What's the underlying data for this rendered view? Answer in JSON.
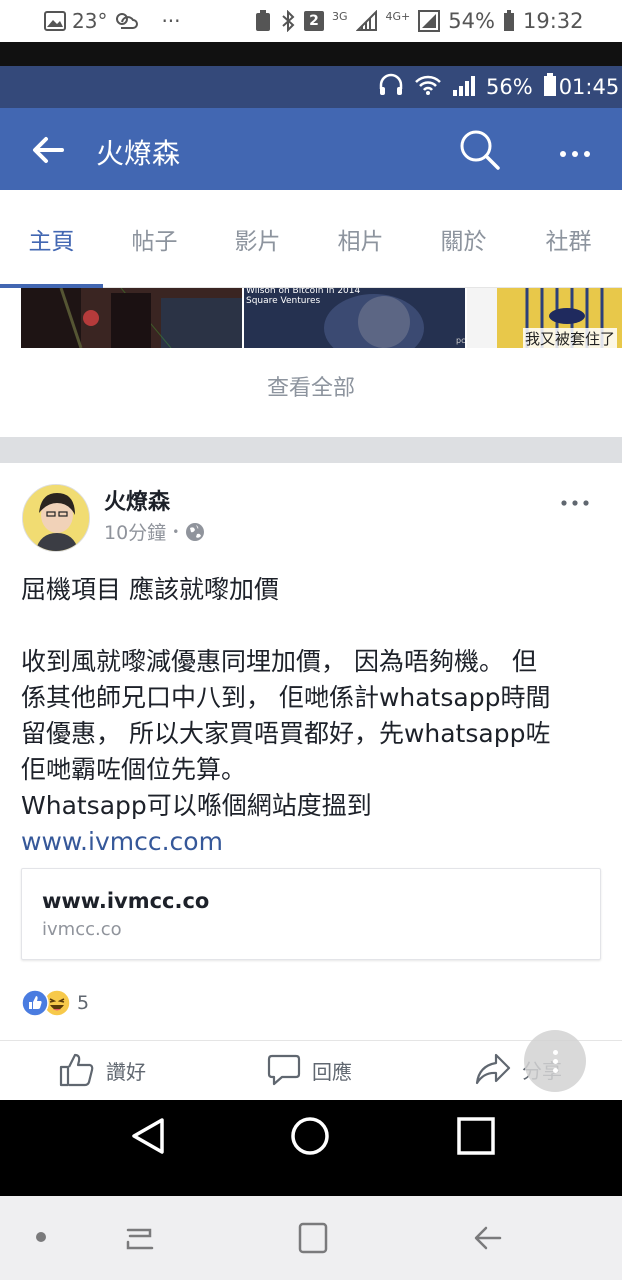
{
  "outer_status": {
    "temperature": "23°",
    "dots": "···",
    "sim_badge": "2",
    "network_3g": "3G",
    "network_4g": "4G+",
    "battery": "54%",
    "time": "19:32"
  },
  "inner_status": {
    "battery": "56%",
    "time": "01:45"
  },
  "header": {
    "title": "火燎森"
  },
  "tabs": [
    {
      "label": "主頁",
      "active": true
    },
    {
      "label": "帖子",
      "active": false
    },
    {
      "label": "影片",
      "active": false
    },
    {
      "label": "相片",
      "active": false
    },
    {
      "label": "關於",
      "active": false
    },
    {
      "label": "社群",
      "active": false
    }
  ],
  "photos": {
    "caption_2_line1": "Wilson on Bitcoin in 2014",
    "caption_2_line2": "Square Ventures",
    "caption_2_corner": "pc",
    "caption_3": "我又被套住了"
  },
  "see_all": "查看全部",
  "post": {
    "author": "火燎森",
    "time": "10分鐘",
    "separator": "•",
    "body_lines": [
      "屈機項目 應該就嚟加價",
      "",
      "收到風就嚟減優惠同埋加價， 因為唔夠機。 但",
      "係其他師兄口中八到， 佢哋係計whatsapp時間",
      "留優惠， 所以大家買唔買都好，先whatsapp咗",
      "佢哋霸咗個位先算。",
      "Whatsapp可以喺個網站度搵到"
    ],
    "link_text": "www.ivmcc.com",
    "card": {
      "title": "www.ivmcc.co",
      "domain": "ivmcc.co"
    },
    "reaction_count": "5",
    "actions": {
      "like": "讚好",
      "comment": "回應",
      "share": "分享"
    }
  },
  "colors": {
    "brand": "#4267b2",
    "status_dark": "#34497a",
    "link": "#365899"
  }
}
